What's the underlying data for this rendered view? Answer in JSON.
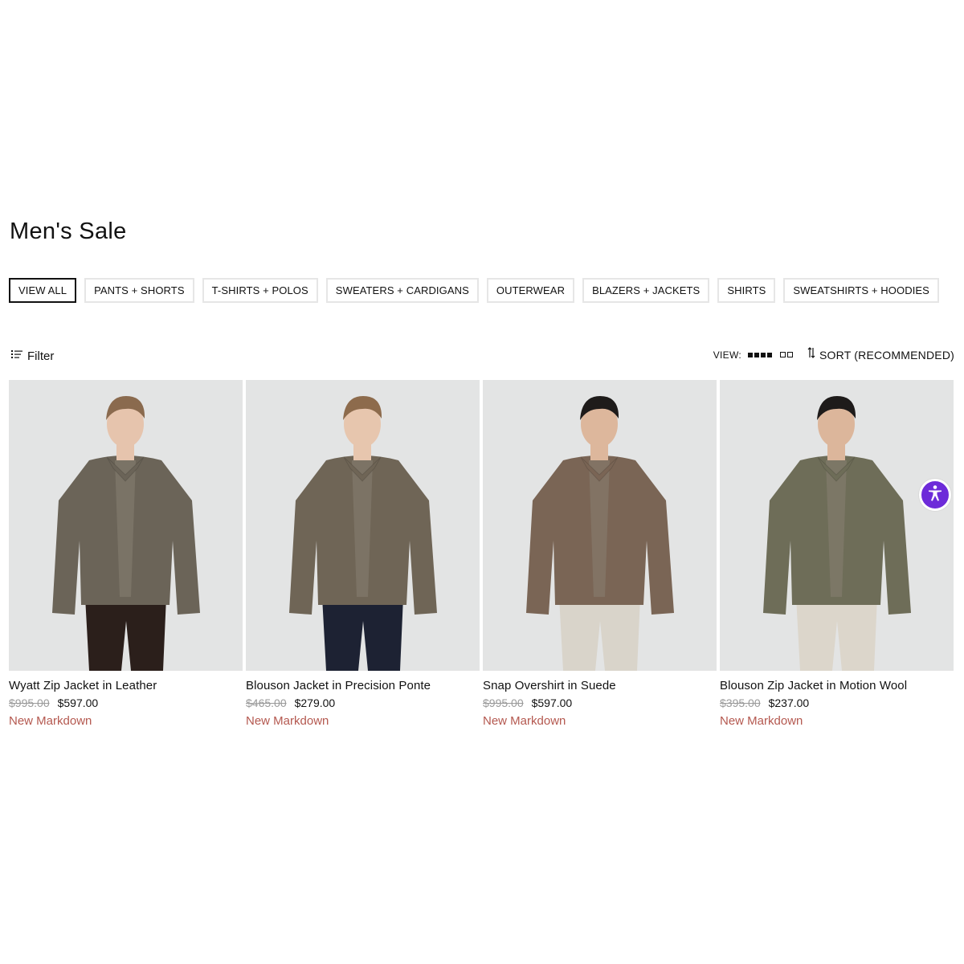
{
  "page": {
    "title": "Men's Sale"
  },
  "categories": [
    {
      "label": "VIEW ALL",
      "active": true
    },
    {
      "label": "PANTS + SHORTS",
      "active": false
    },
    {
      "label": "T-SHIRTS + POLOS",
      "active": false
    },
    {
      "label": "SWEATERS + CARDIGANS",
      "active": false
    },
    {
      "label": "OUTERWEAR",
      "active": false
    },
    {
      "label": "BLAZERS + JACKETS",
      "active": false
    },
    {
      "label": "SHIRTS",
      "active": false
    },
    {
      "label": "SWEATSHIRTS + HOODIES",
      "active": false
    }
  ],
  "toolbar": {
    "filter_label": "Filter",
    "view_label": "VIEW:",
    "sort_label": "SORT (RECOMMENDED)"
  },
  "products": [
    {
      "name": "Wyatt Zip Jacket in Leather",
      "old_price": "$995.00",
      "price": "$597.00",
      "badge": "New Markdown",
      "jacket_color": "#6b6458",
      "pants_color": "#2b1f1b",
      "skin": "#e6c4ad",
      "hair": "#8a6a4e"
    },
    {
      "name": "Blouson Jacket in Precision Ponte",
      "old_price": "$465.00",
      "price": "$279.00",
      "badge": "New Markdown",
      "jacket_color": "#6f6556",
      "pants_color": "#1d2233",
      "skin": "#e7c6ae",
      "hair": "#8d6b4c"
    },
    {
      "name": "Snap Overshirt in Suede",
      "old_price": "$995.00",
      "price": "$597.00",
      "badge": "New Markdown",
      "jacket_color": "#7a6555",
      "pants_color": "#d9d4ca",
      "skin": "#ddb79c",
      "hair": "#1e1b1a"
    },
    {
      "name": "Blouson Zip Jacket in Motion Wool",
      "old_price": "$395.00",
      "price": "$237.00",
      "badge": "New Markdown",
      "jacket_color": "#6e6d58",
      "pants_color": "#dcd6cb",
      "skin": "#dcb69b",
      "hair": "#1e1b1a"
    }
  ],
  "colors": {
    "accent_markdown": "#b4584f",
    "accessibility": "#6d2bd9",
    "image_bg": "#e3e4e4"
  },
  "icons": {
    "filter": "filter-lines-icon",
    "grid4": "grid-four-icon",
    "grid2": "grid-two-icon",
    "sort": "sort-arrows-icon",
    "accessibility": "accessibility-person-icon"
  }
}
